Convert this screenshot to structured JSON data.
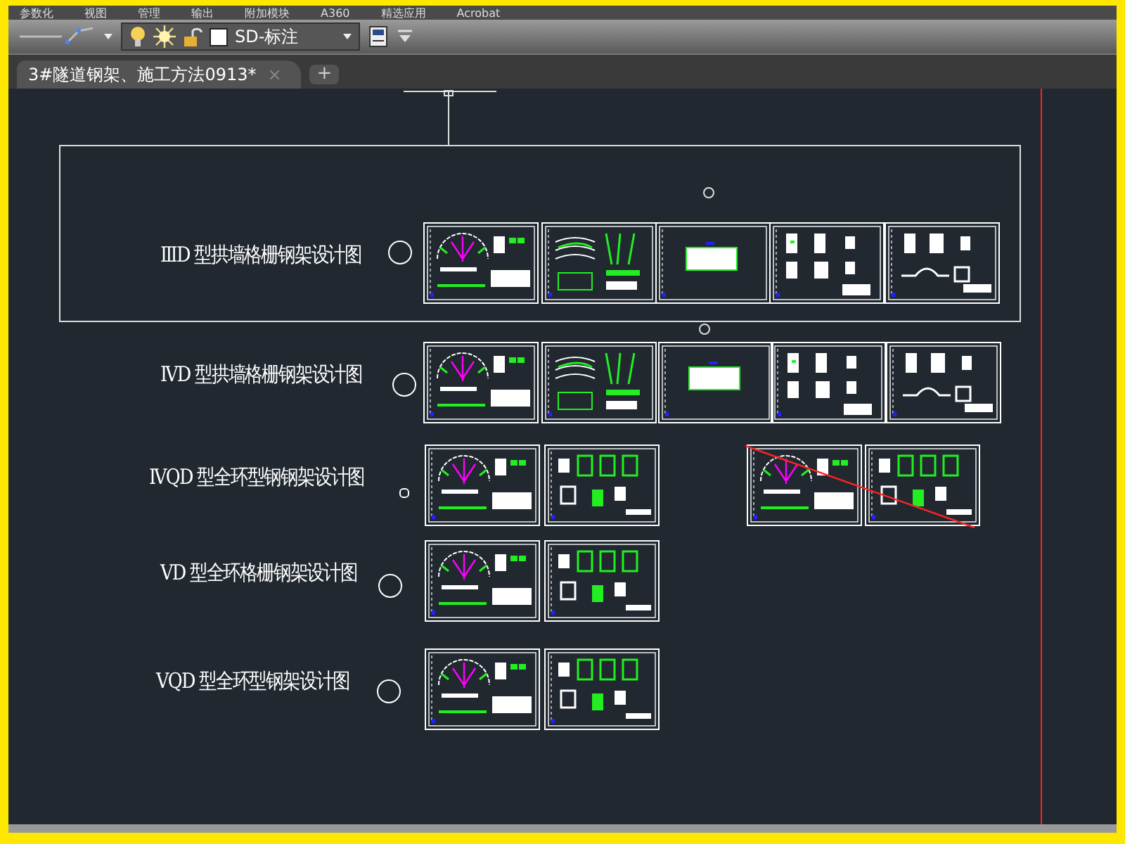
{
  "menu_bar": {
    "items": [
      "参数化",
      "视图",
      "管理",
      "输出",
      "附加模块",
      "A360",
      "精选应用",
      "Acrobat"
    ]
  },
  "layer_toolbar": {
    "layer_name": "SD-标注",
    "layer_on": true,
    "layer_frozen": false,
    "layer_locked": false
  },
  "tabs": [
    {
      "label": "3#隧道钢架、施工方法0913*",
      "selected": true,
      "close": "×"
    }
  ],
  "new_tab": "+",
  "drawing": {
    "selection_box": true,
    "rows": [
      {
        "label": "ⅢD 型拱墙格栅钢架设计图",
        "kind": "circle"
      },
      {
        "label": "ⅣD 型拱墙格栅钢架设计图",
        "kind": "circle"
      },
      {
        "label": "ⅣQD 型全环型钢钢架设计图",
        "kind": "small"
      },
      {
        "label": "ⅤD 型全环格栅钢架设计图",
        "kind": "circle"
      },
      {
        "label": "ⅤQD 型全环型钢架设计图",
        "kind": "circle"
      }
    ]
  }
}
